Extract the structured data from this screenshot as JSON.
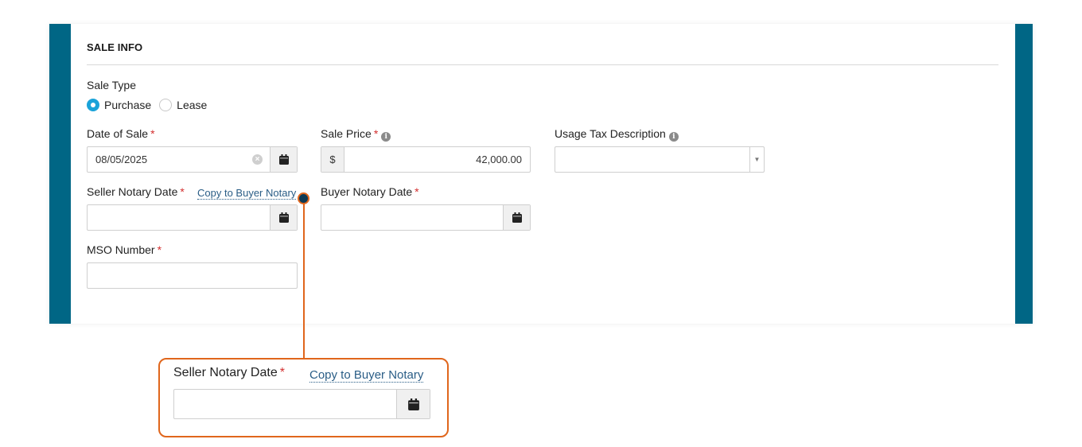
{
  "colors": {
    "accent_bar": "#006685",
    "required": "#d32f2f",
    "radio_selected": "#1aa3d9",
    "link": "#2a5d86",
    "callout": "#e0661c"
  },
  "section": {
    "title": "SALE INFO"
  },
  "sale_type": {
    "label": "Sale Type",
    "options": [
      {
        "label": "Purchase",
        "selected": true
      },
      {
        "label": "Lease",
        "selected": false
      }
    ]
  },
  "fields": {
    "date_of_sale": {
      "label": "Date of Sale",
      "required": "*",
      "value": "08/05/2025",
      "icon": "calendar-icon"
    },
    "sale_price": {
      "label": "Sale Price",
      "required": "*",
      "prefix": "$",
      "value": "42,000.00",
      "icon": "info-icon"
    },
    "usage_tax": {
      "label": "Usage Tax Description",
      "value": "",
      "icon": "info-icon",
      "arrow": "▼"
    },
    "seller_notary_date": {
      "label": "Seller Notary Date",
      "required": "*",
      "value": "",
      "link": "Copy to Buyer Notary"
    },
    "buyer_notary_date": {
      "label": "Buyer Notary Date",
      "required": "*",
      "value": ""
    },
    "mso_number": {
      "label": "MSO Number",
      "required": "*",
      "value": ""
    }
  },
  "callout": {
    "label": "Seller Notary Date",
    "required": "*",
    "link": "Copy to Buyer Notary",
    "value": ""
  }
}
